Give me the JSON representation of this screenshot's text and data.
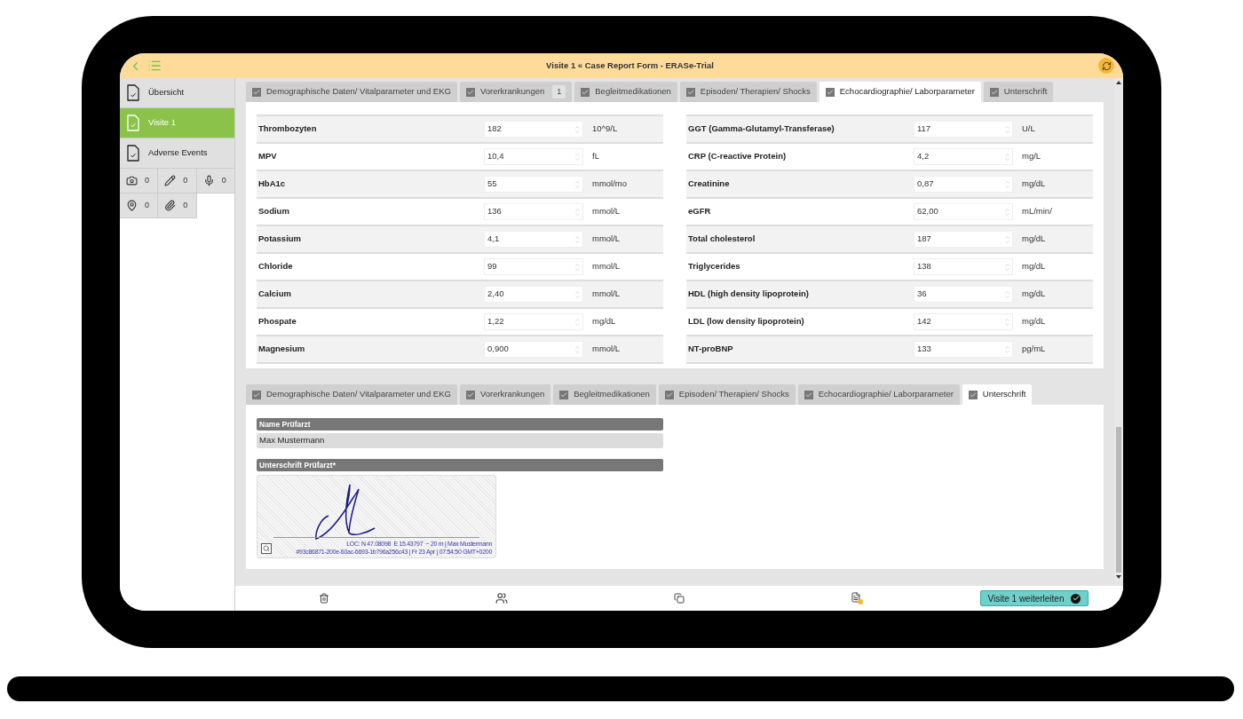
{
  "header": {
    "title": "Visite 1 « Case Report Form - ERASe-Trial"
  },
  "sidebar": {
    "items": [
      {
        "label": "Übersicht",
        "selected": false
      },
      {
        "label": "Visite 1",
        "selected": true
      },
      {
        "label": "Adverse Events",
        "selected": false
      }
    ],
    "attachments": [
      {
        "kind": "camera",
        "count": "0"
      },
      {
        "kind": "pencil",
        "count": "0"
      },
      {
        "kind": "microphone",
        "count": "0"
      },
      {
        "kind": "location",
        "count": "0"
      },
      {
        "kind": "paperclip",
        "count": "0"
      }
    ]
  },
  "top_tabs": [
    {
      "label": "Demographische Daten/ Vitalparameter und EKG",
      "checked": true,
      "selected": false
    },
    {
      "label": "Vorerkrankungen",
      "checked": true,
      "selected": false,
      "badge": "1"
    },
    {
      "label": "Begleitmedikationen",
      "checked": true,
      "selected": false
    },
    {
      "label": "Episoden/ Therapien/ Shocks",
      "checked": true,
      "selected": false
    },
    {
      "label": "Echocardiographie/ Laborparameter",
      "checked": true,
      "selected": true
    },
    {
      "label": "Unterschrift",
      "checked": true,
      "selected": false
    }
  ],
  "lab_table": {
    "left_rows": [
      {
        "name": "Thrombozyten",
        "value": "182",
        "unit": "10^9/L"
      },
      {
        "name": "MPV",
        "value": "10,4",
        "unit": "fL"
      },
      {
        "name": "HbA1c",
        "value": "55",
        "unit": "mmol/mo"
      },
      {
        "name": "Sodium",
        "value": "136",
        "unit": "mmol/L"
      },
      {
        "name": "Potassium",
        "value": "4,1",
        "unit": "mmol/L"
      },
      {
        "name": "Chloride",
        "value": "99",
        "unit": "mmol/L"
      },
      {
        "name": "Calcium",
        "value": "2,40",
        "unit": "mmol/L"
      },
      {
        "name": "Phospate",
        "value": "1,22",
        "unit": "mg/dL"
      },
      {
        "name": "Magnesium",
        "value": "0,900",
        "unit": "mmol/L"
      }
    ],
    "right_rows": [
      {
        "name": "GGT (Gamma-Glutamyl-Transferase)",
        "value": "117",
        "unit": "U/L"
      },
      {
        "name": "CRP (C-reactive Protein)",
        "value": "4,2",
        "unit": "mg/L"
      },
      {
        "name": "Creatinine",
        "value": "0,87",
        "unit": "mg/dL"
      },
      {
        "name": "eGFR",
        "value": "62,00",
        "unit": "mL/min/"
      },
      {
        "name": "Total cholesterol",
        "value": "187",
        "unit": "mg/dL"
      },
      {
        "name": "Triglycerides",
        "value": "138",
        "unit": "mg/dL"
      },
      {
        "name": "HDL (high density lipoprotein)",
        "value": "36",
        "unit": "mg/dL"
      },
      {
        "name": "LDL (low density lipoprotein)",
        "value": "142",
        "unit": "mg/dL"
      },
      {
        "name": "NT-proBNP",
        "value": "133",
        "unit": "pg/mL"
      }
    ]
  },
  "signature_tabs": [
    {
      "label": "Demographische Daten/ Vitalparameter und EKG",
      "checked": true,
      "selected": false
    },
    {
      "label": "Vorerkrankungen",
      "checked": true,
      "selected": false
    },
    {
      "label": "Begleitmedikationen",
      "checked": true,
      "selected": false
    },
    {
      "label": "Episoden/ Therapien/ Shocks",
      "checked": true,
      "selected": false
    },
    {
      "label": "Echocardiographie/ Laborparameter",
      "checked": true,
      "selected": false
    },
    {
      "label": "Unterschrift",
      "checked": true,
      "selected": true
    }
  ],
  "signature_section": {
    "name_label": "Name Prüfarzt",
    "name_value": "Max Mustermann",
    "signature_label": "Unterschrift Prüfarzt*",
    "signature_meta": [
      "LOC: N 47.08098  E 15.43797  ~ 20 m | Max Mustermann",
      "#93c86871-200e-60ac-6693-1b796a256c43 | Fr 23 Apr | 07:54:50 GMT+0200"
    ]
  },
  "toolbar": {
    "forward_button": "Visite 1 weiterleiten"
  }
}
